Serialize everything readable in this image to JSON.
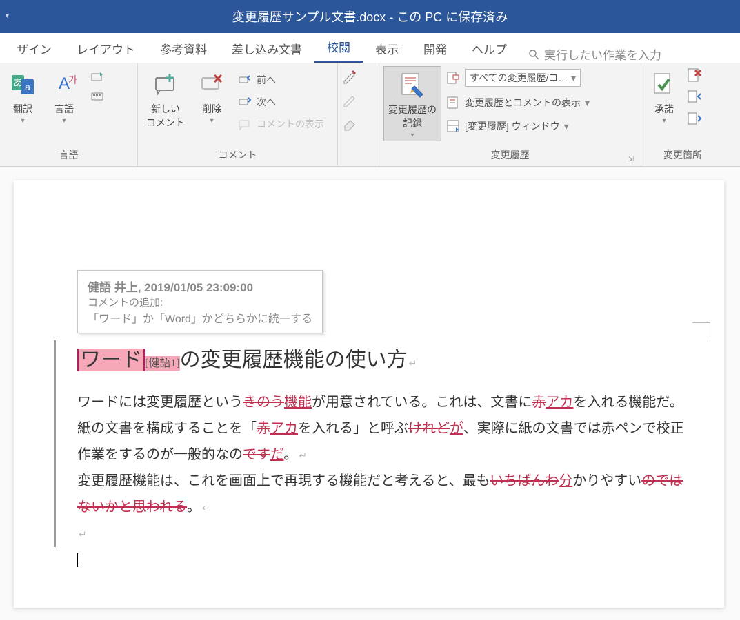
{
  "titlebar": {
    "title": "変更履歴サンプル文書.docx - この PC に保存済み"
  },
  "tabs": {
    "items": [
      "ザイン",
      "レイアウト",
      "参考資料",
      "差し込み文書",
      "校閲",
      "表示",
      "開発",
      "ヘルプ"
    ],
    "activeIndex": 4,
    "searchPlaceholder": "実行したい作業を入力"
  },
  "ribbon": {
    "language": {
      "label": "言語",
      "translate": "翻訳",
      "langbtn": "言語"
    },
    "comment": {
      "label": "コメント",
      "new": "新しい\nコメント",
      "delete": "削除",
      "prev": "前へ",
      "next": "次へ",
      "show": "コメントの表示"
    },
    "pens": {
      "ink": "ink",
      "eraser": "eraser",
      "pen": "pen"
    },
    "tracking": {
      "label": "変更履歴",
      "record": "変更履歴の\n記録",
      "displaySelect": "すべての変更履歴/コ…",
      "showMarkup": "変更履歴とコメントの表示",
      "reviewingPane": "[変更履歴] ウィンドウ"
    },
    "changes": {
      "label": "変更箇所",
      "accept": "承諾"
    }
  },
  "tooltip": {
    "author": "健語 井上, 2019/01/05 23:09:00",
    "label": "コメントの追加:",
    "body": "「ワード」か「Word」かどちらかに統一する"
  },
  "doc": {
    "headingHighlight": "ワード",
    "headingAnnot": "[健語1]",
    "headingRest": "の変更履歴機能の使い方",
    "p1_a": "ワードには変更履歴という",
    "p1_del1": "きのう",
    "p1_ins1": "機能",
    "p1_b": "が用意されている。これは、文書に",
    "p1_del2": "赤",
    "p1_ins2": "アカ",
    "p1_c": "を入れる機能だ。紙の文書を構成することを「",
    "p1_del3": "赤",
    "p1_ins3": "アカ",
    "p1_d": "を入れる」と呼ぶ",
    "p1_del4": "けれど",
    "p1_ins4": "が",
    "p1_e": "、実際に紙の文書では赤ペンで校正作業をするのが一般的なの",
    "p1_del5": "です",
    "p1_ins5": "だ",
    "p1_f": "。",
    "p2_a": "変更履歴機能は、これを画面上で再現する機能だと考えると、最も",
    "p2_del1": "いちばんわ",
    "p2_ins1": "分",
    "p2_b": "かりやすい",
    "p2_del2": "のではないかと思われる",
    "p2_c": "。"
  }
}
